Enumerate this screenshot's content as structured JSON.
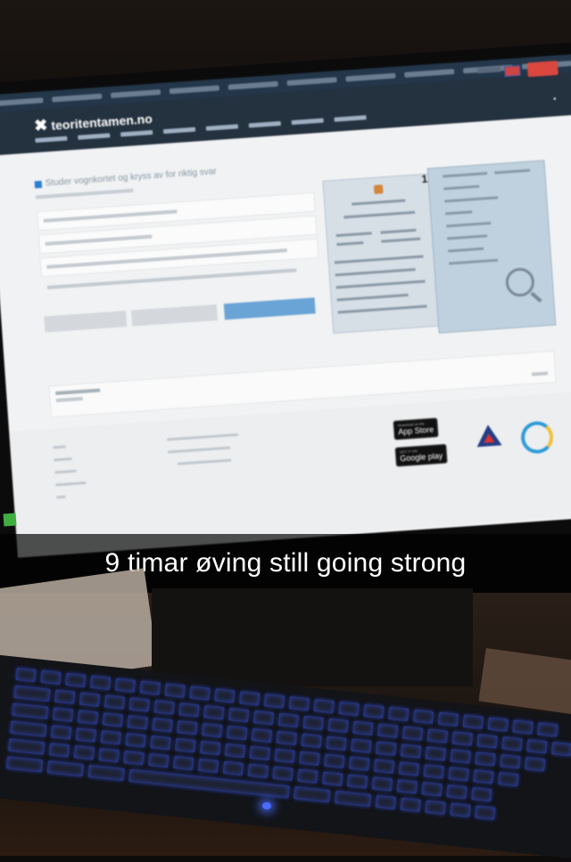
{
  "snap_caption": "9 timar øving still going strong",
  "website": {
    "logo_text": "teoritentamen.no",
    "question_heading": "Studer vognkortet og kryss av for riktig svar",
    "marks": {
      "document_number": "1"
    },
    "store_badges": {
      "app_store": "App Store",
      "app_store_small": "Download on the",
      "google_play": "Google play",
      "google_play_small": "GET IT ON"
    }
  },
  "keyboard_led_color": "#3a5cff"
}
